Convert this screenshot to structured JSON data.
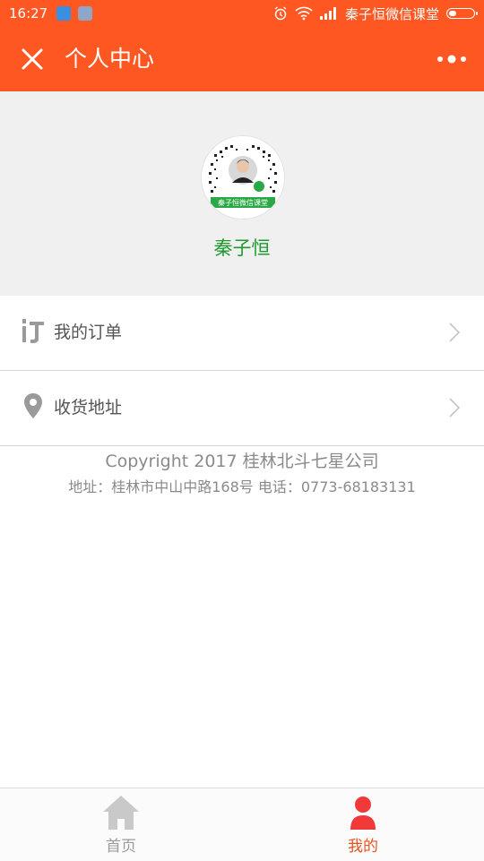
{
  "status_bar": {
    "time": "16:27",
    "carrier": "秦子恒微信课堂",
    "icons": [
      "upload-app-icon",
      "note-app-icon",
      "alarm-icon",
      "wifi-icon",
      "signal-icon",
      "battery-icon"
    ]
  },
  "nav": {
    "title": "个人中心",
    "close_icon": "close-icon",
    "more_icon": "more-dots-icon"
  },
  "profile": {
    "name": "秦子恒",
    "avatar_icon": "qr-code-avatar-icon",
    "avatar_caption": "秦子恒微信课堂"
  },
  "menu": {
    "items": [
      {
        "label": "我的订单",
        "icon": "order-icon"
      },
      {
        "label": "收货地址",
        "icon": "location-pin-icon"
      }
    ]
  },
  "footer": {
    "copyright": "Copyright 2017 桂林北斗七星公司",
    "address": "地址：桂林市中山中路168号 电话：0773-68183131"
  },
  "tabbar": {
    "tabs": [
      {
        "label": "首页",
        "icon": "home-icon",
        "active": false
      },
      {
        "label": "我的",
        "icon": "user-icon",
        "active": true
      }
    ]
  },
  "colors": {
    "brand": "#ff5722",
    "name_green": "#1e9b2f",
    "active_tab": "#e8541e",
    "inactive_tab": "#9a9a9a"
  }
}
